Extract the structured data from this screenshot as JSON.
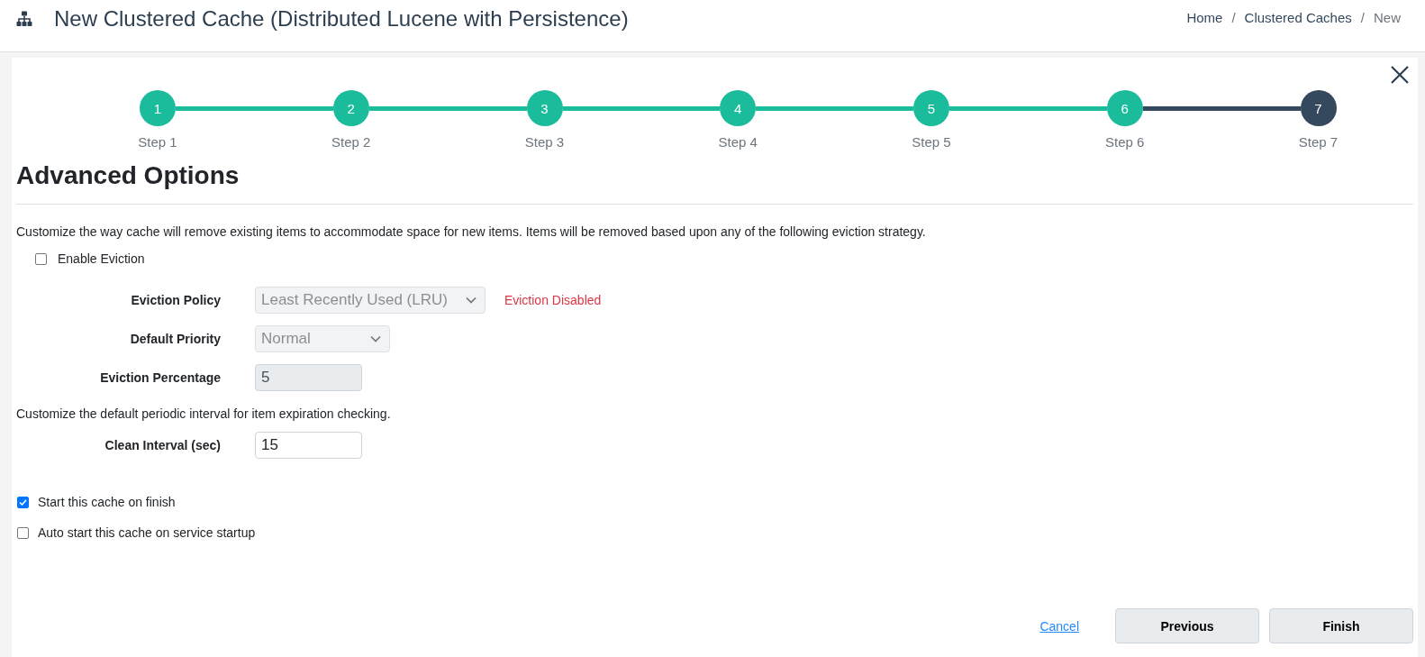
{
  "header": {
    "title": "New Clustered Cache (Distributed Lucene with Persistence)",
    "breadcrumb": [
      {
        "kind": "link",
        "label": "Home"
      },
      {
        "kind": "separator",
        "label": "/"
      },
      {
        "kind": "link",
        "label": "Clustered Caches"
      },
      {
        "kind": "separator",
        "label": "/"
      },
      {
        "kind": "current",
        "label": "New"
      }
    ]
  },
  "wizard": {
    "steps": [
      {
        "number": "1",
        "label": "Step 1",
        "selected": false
      },
      {
        "number": "2",
        "label": "Step 2",
        "selected": false
      },
      {
        "number": "3",
        "label": "Step 3",
        "selected": false
      },
      {
        "number": "4",
        "label": "Step 4",
        "selected": false
      },
      {
        "number": "5",
        "label": "Step 5",
        "selected": false
      },
      {
        "number": "6",
        "label": "Step 6",
        "selected": false
      },
      {
        "number": "7",
        "label": "Step 7",
        "selected": true
      }
    ],
    "section_title": "Advanced Options",
    "eviction": {
      "description": "Customize the way cache will remove existing items to accommodate space for new items. Items will be removed based upon any of the following eviction strategy.",
      "enable": {
        "label": "Enable Eviction",
        "checked": false
      },
      "fields": [
        {
          "kind": "select",
          "label": "Eviction Policy",
          "value": "Least Recently Used (LRU)",
          "disabled": true,
          "note": "Eviction Disabled"
        },
        {
          "kind": "select",
          "label": "Default Priority",
          "value": "Normal",
          "disabled": true
        },
        {
          "kind": "text",
          "label": "Eviction Percentage",
          "value": "5",
          "disabled": true
        }
      ]
    },
    "expiration": {
      "description": "Customize the default periodic interval for item expiration checking.",
      "fields": [
        {
          "kind": "text",
          "label": "Clean Interval (sec)",
          "value": "15",
          "disabled": false
        }
      ]
    },
    "options": [
      {
        "label": "Start this cache on finish",
        "checked": true
      },
      {
        "label": "Auto start this cache on service startup",
        "checked": false
      }
    ],
    "footer": {
      "cancel": "Cancel",
      "buttons": [
        "Previous",
        "Finish"
      ]
    }
  }
}
